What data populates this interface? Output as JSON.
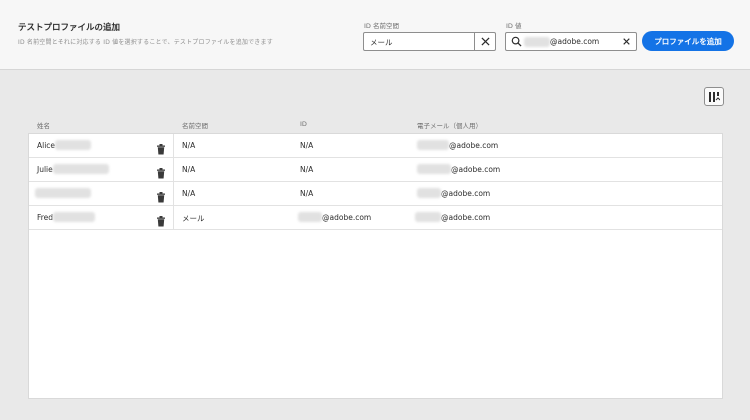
{
  "header": {
    "title": "テストプロファイルの追加",
    "subtitle": "ID 名前空間とそれに対応する ID 値を選択することで、テストプロファイルを追加できます"
  },
  "namespace_field": {
    "label": "ID 名前空間",
    "value": "メール"
  },
  "value_field": {
    "label": "ID 値",
    "value": "@adobe.com"
  },
  "add_button": {
    "label": "プロファイルを追加"
  },
  "table": {
    "columns": [
      "姓名",
      "名前空間",
      "ID",
      "電子メール（個人用）"
    ],
    "rows": [
      {
        "name": "Alice",
        "namespace": "N/A",
        "id": "N/A",
        "email": "@adobe.com"
      },
      {
        "name": "Julie",
        "namespace": "N/A",
        "id": "N/A",
        "email": "@adobe.com"
      },
      {
        "name": "",
        "namespace": "N/A",
        "id": "N/A",
        "email": "@adobe.com"
      },
      {
        "name": "Fred",
        "namespace": "メール",
        "id": "@adobe.com",
        "email": "@adobe.com"
      }
    ]
  },
  "colors": {
    "accent": "#1473e6",
    "header_bg": "#f7f7f7",
    "page_bg": "#e9e9e9"
  },
  "icons": [
    "close-icon",
    "search-icon",
    "column-settings-icon",
    "trash-icon"
  ]
}
